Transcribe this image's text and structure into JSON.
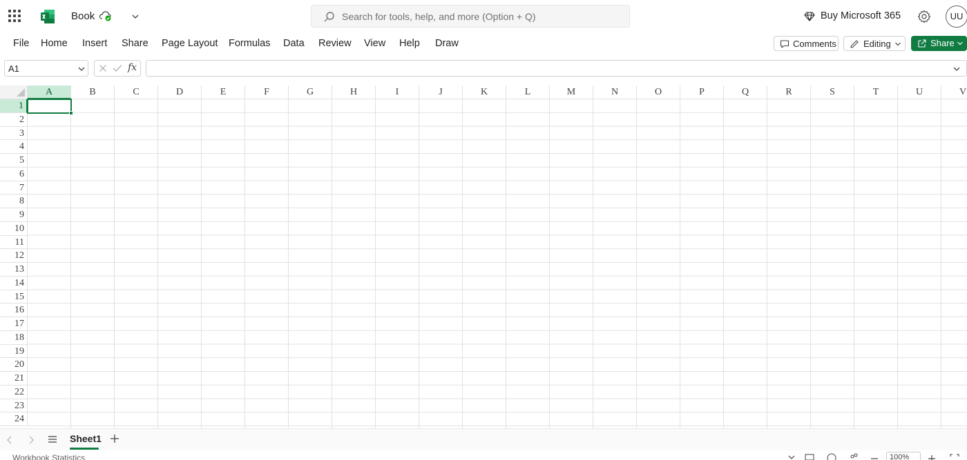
{
  "app": {
    "doc_name": "Book",
    "search_placeholder": "Search for tools, help, and more (Option + Q)",
    "buy_label": "Buy Microsoft 365",
    "avatar_initials": "UU",
    "brand_color": "#107c41"
  },
  "menu": {
    "items": [
      "File",
      "Home",
      "Insert",
      "Share",
      "Page Layout",
      "Formulas",
      "Data",
      "Review",
      "View",
      "Help",
      "Draw"
    ],
    "comments_label": "Comments",
    "editing_label": "Editing",
    "share_label": "Share"
  },
  "formula_bar": {
    "name_box": "A1",
    "fx_label": "fx",
    "formula_value": ""
  },
  "grid": {
    "columns": [
      "A",
      "B",
      "C",
      "D",
      "E",
      "F",
      "G",
      "H",
      "I",
      "J",
      "K",
      "L",
      "M",
      "N",
      "O",
      "P",
      "Q",
      "R",
      "S",
      "T",
      "U",
      "V"
    ],
    "rows": [
      "1",
      "2",
      "3",
      "4",
      "5",
      "6",
      "7",
      "8",
      "9",
      "10",
      "11",
      "12",
      "13",
      "14",
      "15",
      "16",
      "17",
      "18",
      "19",
      "20",
      "21",
      "22",
      "23",
      "24"
    ],
    "active_cell": "A1",
    "selected_column": "A",
    "selected_row": "1"
  },
  "sheets": {
    "tabs": [
      "Sheet1"
    ],
    "active": "Sheet1"
  },
  "status": {
    "workbook_stats": "Workbook Statistics",
    "zoom": "100%"
  }
}
